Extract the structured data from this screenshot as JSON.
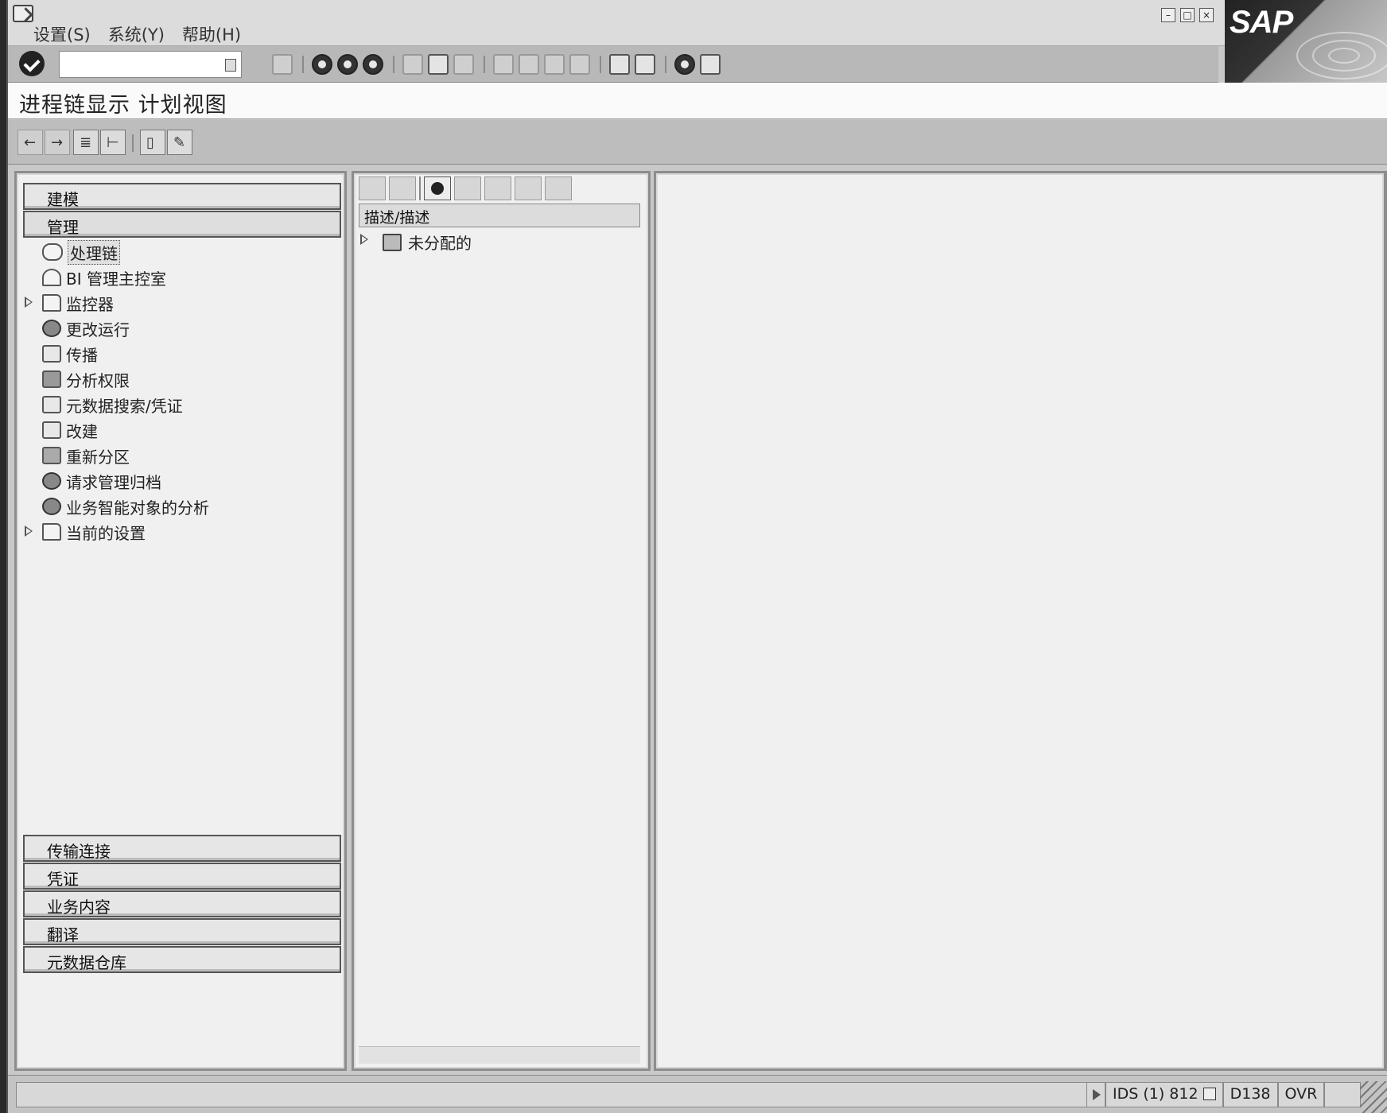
{
  "menubar": {
    "items": [
      "设置(S)",
      "系统(Y)",
      "帮助(H)"
    ],
    "logo": "SAP"
  },
  "title": "进程链显示 计划视图",
  "navigator": {
    "sections_top": [
      "建模",
      "管理"
    ],
    "tree": [
      {
        "label": "处理链",
        "icon": "chain-link-icon",
        "selected": true,
        "expandable": false
      },
      {
        "label": "BI 管理主控室",
        "icon": "person-icon",
        "selected": false,
        "expandable": false
      },
      {
        "label": "监控器",
        "icon": "folder-icon",
        "selected": false,
        "expandable": true
      },
      {
        "label": "更改运行",
        "icon": "gears-icon",
        "selected": false,
        "expandable": false
      },
      {
        "label": "传播",
        "icon": "propagate-icon",
        "selected": false,
        "expandable": false
      },
      {
        "label": "分析权限",
        "icon": "authorization-icon",
        "selected": false,
        "expandable": false
      },
      {
        "label": "元数据搜索/凭证",
        "icon": "metadata-search-icon",
        "selected": false,
        "expandable": false
      },
      {
        "label": "改建",
        "icon": "remodel-icon",
        "selected": false,
        "expandable": false
      },
      {
        "label": "重新分区",
        "icon": "repartition-icon",
        "selected": false,
        "expandable": false
      },
      {
        "label": "请求管理归档",
        "icon": "gear-icon",
        "selected": false,
        "expandable": false
      },
      {
        "label": "业务智能对象的分析",
        "icon": "gear-icon",
        "selected": false,
        "expandable": false
      },
      {
        "label": "当前的设置",
        "icon": "folder-icon",
        "selected": false,
        "expandable": true
      }
    ],
    "sections_bottom": [
      "传输连接",
      "凭证",
      "业务内容",
      "翻译",
      "元数据仓库"
    ]
  },
  "chain_list": {
    "column_header": "描述/描述",
    "items": [
      {
        "label": "未分配的",
        "icon": "hierarchy-icon",
        "expandable": true
      }
    ]
  },
  "statusbar": {
    "system": "IDS (1) 812",
    "server": "D138",
    "mode": "OVR"
  }
}
